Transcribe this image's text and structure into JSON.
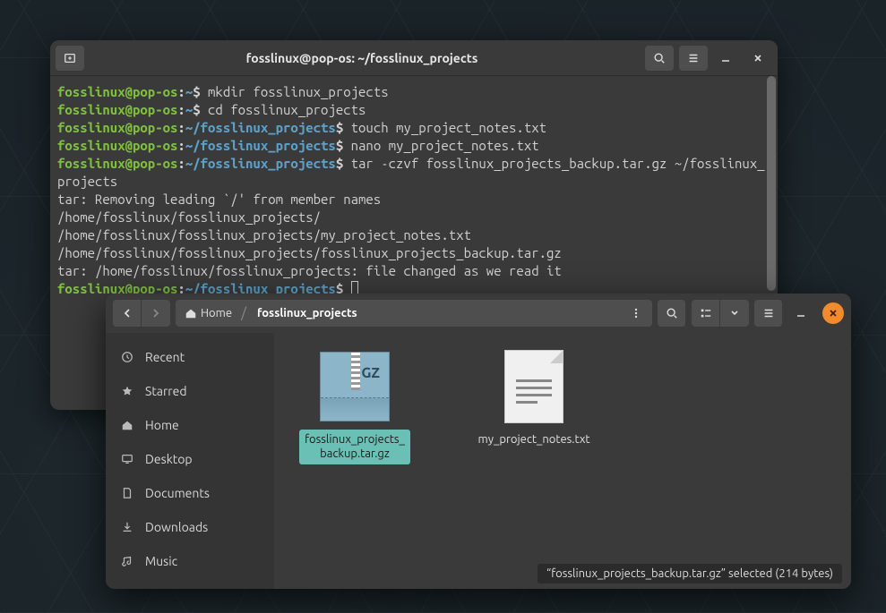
{
  "terminal": {
    "title": "fosslinux@pop-os: ~/fosslinux_projects",
    "user": "fosslinux@pop-os",
    "home": "~",
    "path": "~/fosslinux_projects",
    "lines": {
      "l1_cmd": " mkdir fosslinux_projects",
      "l2_cmd": " cd fosslinux_projects",
      "l3_cmd": " touch my_project_notes.txt",
      "l4_cmd": " nano my_project_notes.txt",
      "l5_cmd": " tar -czvf fosslinux_projects_backup.tar.gz ~/fosslinux_projects",
      "o1": "tar: Removing leading `/' from member names",
      "o2": "/home/fosslinux/fosslinux_projects/",
      "o3": "/home/fosslinux/fosslinux_projects/my_project_notes.txt",
      "o4": "/home/fosslinux/fosslinux_projects/fosslinux_projects_backup.tar.gz",
      "o5": "tar: /home/fosslinux/fosslinux_projects: file changed as we read it"
    }
  },
  "files": {
    "breadcrumb": {
      "home": "Home",
      "current": "fosslinux_projects"
    },
    "sidebar": {
      "items": [
        {
          "label": "Recent",
          "icon": "clock-icon"
        },
        {
          "label": "Starred",
          "icon": "star-icon"
        },
        {
          "label": "Home",
          "icon": "home-icon"
        },
        {
          "label": "Desktop",
          "icon": "desktop-icon"
        },
        {
          "label": "Documents",
          "icon": "document-icon"
        },
        {
          "label": "Downloads",
          "icon": "download-icon"
        },
        {
          "label": "Music",
          "icon": "music-icon"
        }
      ]
    },
    "gz_label_top": "fosslinux_projects_",
    "gz_label_bot": "backup.tar.gz",
    "gz_badge": "GZ",
    "txt_label": "my_project_notes.txt",
    "status": "“fosslinux_projects_backup.tar.gz” selected  (214 bytes)"
  }
}
